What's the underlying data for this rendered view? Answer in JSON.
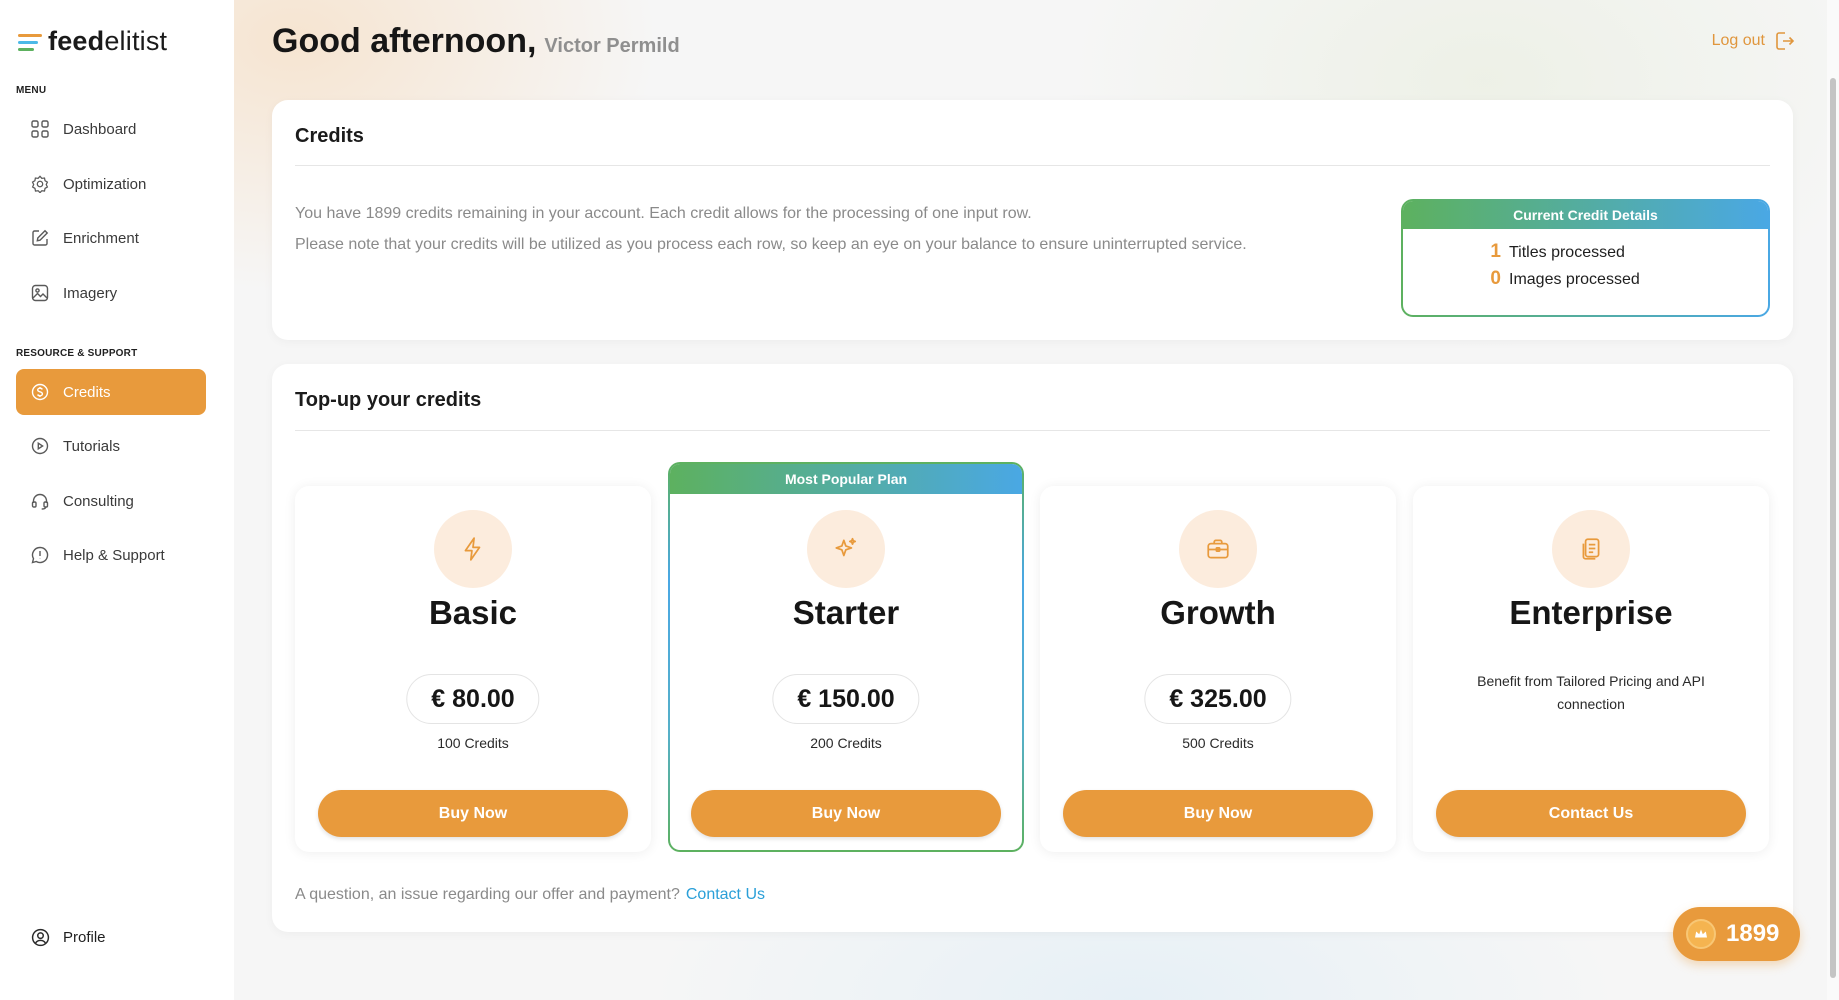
{
  "brand": {
    "bold": "feed",
    "light": "elitist"
  },
  "sidebar": {
    "menu_label": "MENU",
    "menu_items": [
      {
        "label": "Dashboard",
        "icon": "grid-icon"
      },
      {
        "label": "Optimization",
        "icon": "gear-icon"
      },
      {
        "label": "Enrichment",
        "icon": "edit-icon"
      },
      {
        "label": "Imagery",
        "icon": "image-icon"
      }
    ],
    "resource_label": "RESOURCE & SUPPORT",
    "resource_items": [
      {
        "label": "Credits",
        "icon": "dollar-icon",
        "active": true
      },
      {
        "label": "Tutorials",
        "icon": "play-icon"
      },
      {
        "label": "Consulting",
        "icon": "headset-icon"
      },
      {
        "label": "Help & Support",
        "icon": "help-icon"
      }
    ],
    "profile_label": "Profile"
  },
  "header": {
    "greeting": "Good afternoon,",
    "user_name": "Victor Permild",
    "logout_label": "Log out"
  },
  "credits": {
    "title": "Credits",
    "line1": "You have 1899 credits remaining in your account. Each credit allows for the processing of one input row.",
    "line2": "Please note that your credits will be utilized as you process each row, so keep an eye on your balance to ensure uninterrupted service.",
    "details": {
      "title": "Current Credit Details",
      "titles_count": "1",
      "titles_label": "Titles processed",
      "images_count": "0",
      "images_label": "Images processed"
    }
  },
  "topup": {
    "title": "Top-up your credits",
    "popular_badge": "Most Popular Plan",
    "plans": [
      {
        "name": "Basic",
        "price": "€ 80.00",
        "credits": "100 Credits",
        "button": "Buy Now",
        "icon": "lightning-icon"
      },
      {
        "name": "Starter",
        "price": "€ 150.00",
        "credits": "200 Credits",
        "button": "Buy Now",
        "icon": "sparkle-icon"
      },
      {
        "name": "Growth",
        "price": "€ 325.00",
        "credits": "500 Credits",
        "button": "Buy Now",
        "icon": "briefcase-icon"
      },
      {
        "name": "Enterprise",
        "description": "Benefit from Tailored Pricing and API connection",
        "button": "Contact Us",
        "icon": "document-icon"
      }
    ],
    "question": "A question, an issue regarding our offer and payment?",
    "contact_link": "Contact Us"
  },
  "balance_badge": {
    "value": "1899",
    "icon": "coin-icon"
  },
  "colors": {
    "accent": "#e89a3c",
    "gradient_green": "#5db15f",
    "gradient_blue": "#4aa8e4",
    "link": "#2a9fd8"
  }
}
